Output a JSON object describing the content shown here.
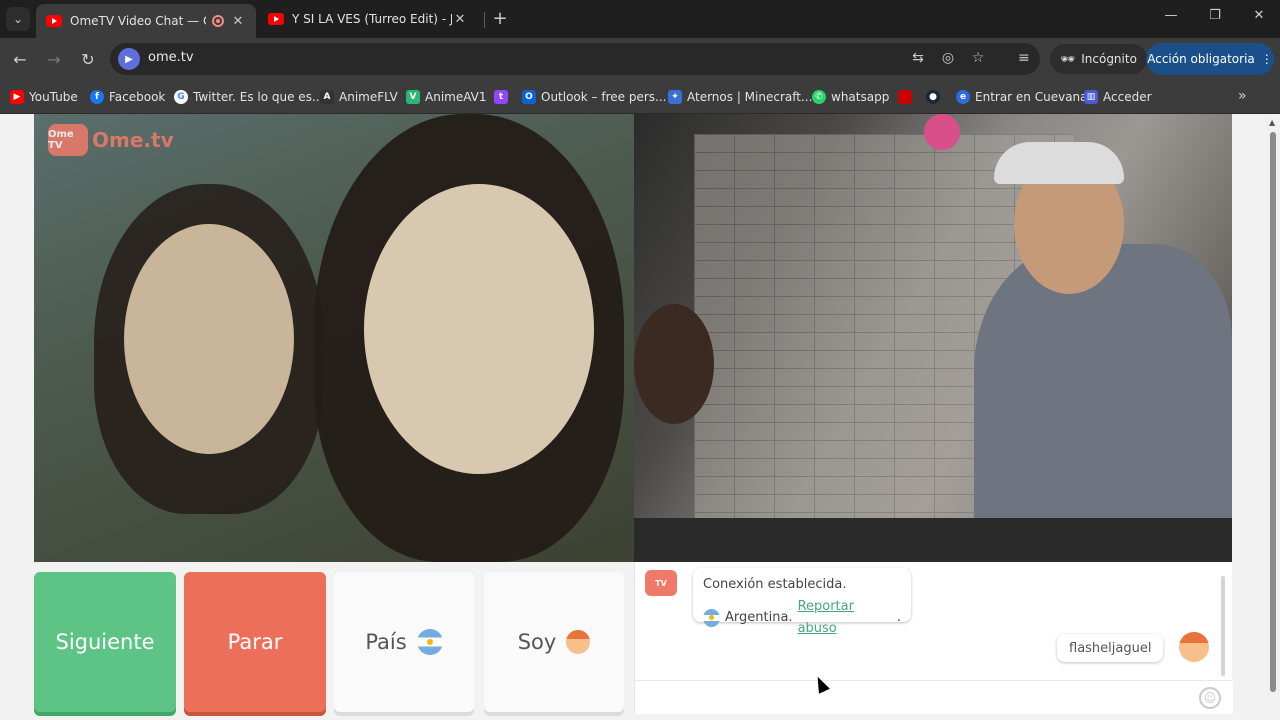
{
  "tabs": [
    {
      "title": "OmeTV Video Chat — Ome",
      "active": true
    },
    {
      "title": "Y SI LA VES (Turreo Edit) - Jona",
      "active": false
    }
  ],
  "toolbar": {
    "url": "ome.tv",
    "incognito_label": "Incógnito",
    "action_label": "Acción obligatoria"
  },
  "bookmarks": [
    {
      "label": "YouTube",
      "icon": "youtube-icon",
      "color": "#ff0000"
    },
    {
      "label": "Facebook",
      "icon": "facebook-icon",
      "color": "#1877f2"
    },
    {
      "label": "Twitter. Es lo que es...",
      "icon": "google-icon",
      "color": "#ffffff"
    },
    {
      "label": "AnimeFLV",
      "icon": "animeflv-icon",
      "color": "#333333"
    },
    {
      "label": "AnimeAV1",
      "icon": "animeav1-icon",
      "color": "#2bb673"
    },
    {
      "label": "",
      "icon": "twitch-icon",
      "color": "#9146ff"
    },
    {
      "label": "Outlook – free pers...",
      "icon": "outlook-icon",
      "color": "#0a64d6"
    },
    {
      "label": "Aternos | Minecraft...",
      "icon": "aternos-icon",
      "color": "#3b6fd1"
    },
    {
      "label": "whatsapp",
      "icon": "whatsapp-icon",
      "color": "#25d366"
    },
    {
      "label": "",
      "icon": "red-bookmark-icon",
      "color": "#cc0000"
    },
    {
      "label": "",
      "icon": "steam-icon",
      "color": "#1b2838"
    },
    {
      "label": "Entrar en Cuevana",
      "icon": "cuevana-icon",
      "color": "#2d6cdf"
    },
    {
      "label": "Acceder",
      "icon": "acceder-icon",
      "color": "#4a5cd1"
    }
  ],
  "ome": {
    "logo_text": "Ome.tv",
    "logo_badge": "Ome TV",
    "buttons": {
      "next": "Siguiente",
      "stop": "Parar",
      "country": "País",
      "gender": "Soy"
    },
    "chat": {
      "system_line1": "Conexión establecida.",
      "system_country": "Argentina.",
      "report_link": "Reportar abuso",
      "report_suffix": ".",
      "my_message": "flasheljaguel"
    }
  },
  "colors": {
    "next": "#5ec485",
    "stop": "#ec6f5a",
    "link": "#4aa77a",
    "action": "#1a4f8a"
  }
}
